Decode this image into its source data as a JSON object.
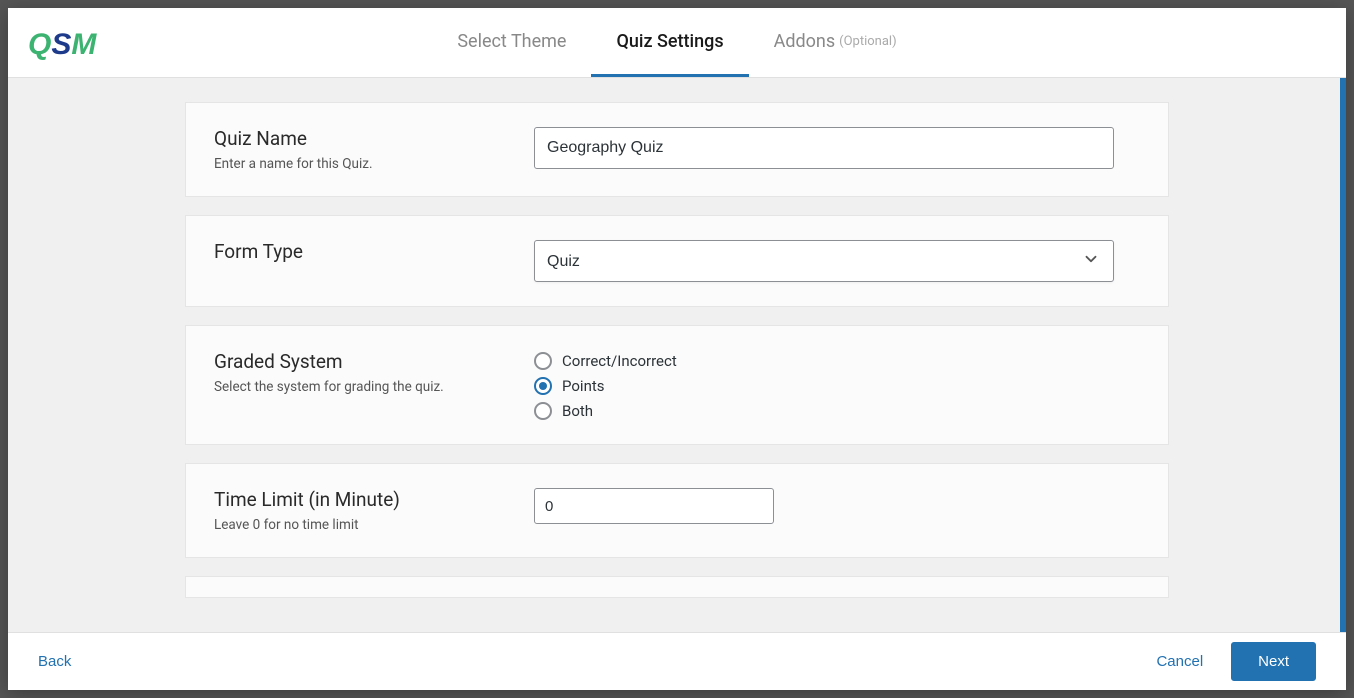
{
  "tabs": {
    "select_theme": "Select Theme",
    "quiz_settings": "Quiz Settings",
    "addons": "Addons",
    "addons_optional": "(Optional)"
  },
  "settings": {
    "quiz_name": {
      "label": "Quiz Name",
      "desc": "Enter a name for this Quiz.",
      "value": "Geography Quiz"
    },
    "form_type": {
      "label": "Form Type",
      "value": "Quiz"
    },
    "graded_system": {
      "label": "Graded System",
      "desc": "Select the system for grading the quiz.",
      "options": {
        "correct": "Correct/Incorrect",
        "points": "Points",
        "both": "Both"
      },
      "selected": "points"
    },
    "time_limit": {
      "label": "Time Limit (in Minute)",
      "desc": "Leave 0 for no time limit",
      "value": "0"
    }
  },
  "footer": {
    "back": "Back",
    "cancel": "Cancel",
    "next": "Next"
  }
}
